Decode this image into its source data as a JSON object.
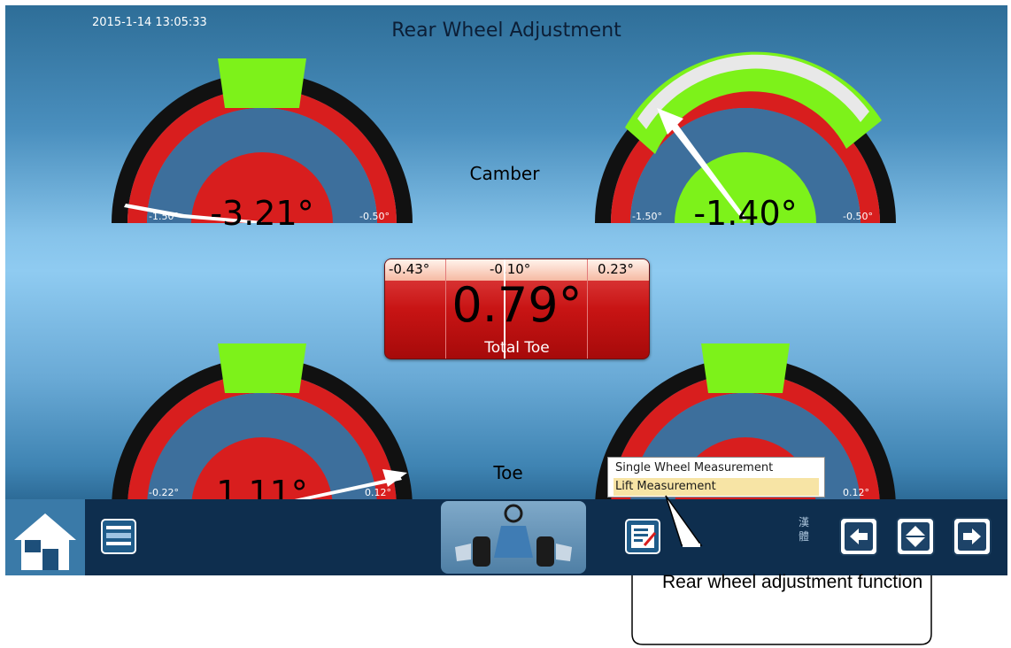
{
  "header": {
    "timestamp": "2015-1-14 13:05:33",
    "title": "Rear Wheel Adjustment"
  },
  "sections": {
    "camber_label": "Camber",
    "toe_label": "Toe"
  },
  "gauges": {
    "camber_left": {
      "value": "-3.21°",
      "min_label": "-1.50°",
      "max_label": "-0.50°",
      "in_range": false
    },
    "camber_right": {
      "value": "-1.40°",
      "min_label": "-1.50°",
      "max_label": "-0.50°",
      "in_range": true
    },
    "toe_left": {
      "value": "1.11°",
      "min_label": "-0.22°",
      "max_label": "0.12°",
      "in_range": false
    },
    "toe_right": {
      "value": "",
      "min_label": "",
      "max_label": "0.12°",
      "in_range": false
    }
  },
  "total_toe": {
    "min_label": "-0.43°",
    "center_label": "-0.10°",
    "max_label": "0.23°",
    "value": "0.79°",
    "caption": "Total Toe"
  },
  "popup_menu": {
    "items": [
      "Single Wheel Measurement",
      "Lift Measurement"
    ],
    "selected": "Lift Measurement"
  },
  "toolbar": {
    "ime_label": "漢 體",
    "icons": [
      "home-icon",
      "settings-list-icon",
      "vehicle-icon",
      "checklist-icon",
      "arrow-left-icon",
      "diamond-icon",
      "arrow-right-icon"
    ]
  },
  "callout": {
    "text": "Rear wheel adjustment function"
  },
  "colors": {
    "out_of_range": "#d81e1e",
    "in_range": "#7df21a",
    "toolbar": "#0e2e4e",
    "gauge_outer": "#111111"
  }
}
